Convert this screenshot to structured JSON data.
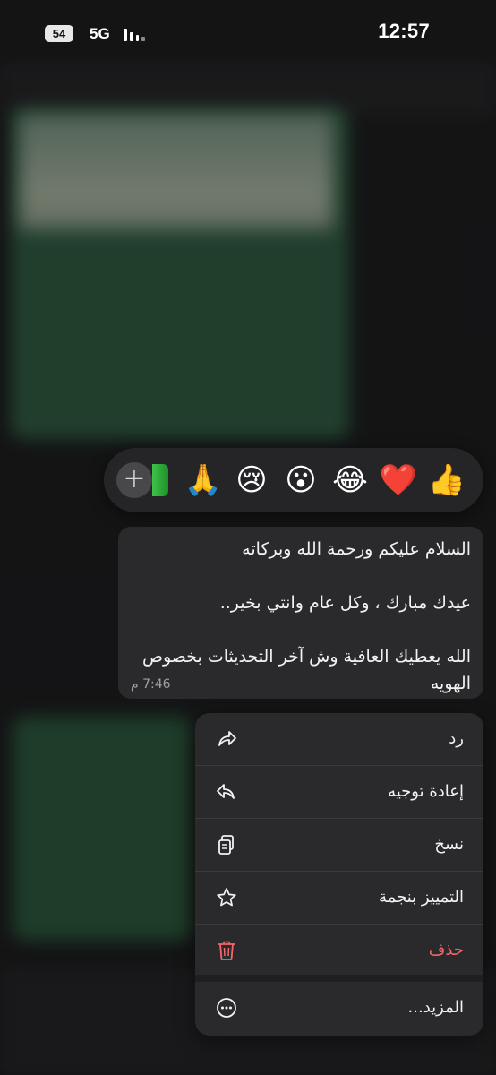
{
  "status_bar": {
    "time": "12:57",
    "network": "5G",
    "battery": "54"
  },
  "reactions": {
    "add_label": "+",
    "items": [
      {
        "name": "thumbs-up",
        "emoji": "👍"
      },
      {
        "name": "red-heart",
        "emoji": "❤️"
      },
      {
        "name": "tears-of-joy",
        "emoji": "😂"
      },
      {
        "name": "surprised",
        "emoji": "😮"
      },
      {
        "name": "crying",
        "emoji": "😢"
      },
      {
        "name": "praying-hands",
        "emoji": "🙏"
      }
    ]
  },
  "message": {
    "line1": "السلام عليكم ورحمة الله وبركاته",
    "line2": "عيدك مبارك ، وكل عام وانتي بخير..",
    "line3": "الله يعطيك العافية وش آخر التحديثات بخصوص الهويه",
    "time": "7:46 م"
  },
  "menu": {
    "reply": {
      "label": "رد",
      "icon": "reply-icon"
    },
    "forward": {
      "label": "إعادة توجيه",
      "icon": "forward-icon"
    },
    "copy": {
      "label": "نسخ",
      "icon": "copy-icon"
    },
    "star": {
      "label": "التمييز بنجمة",
      "icon": "star-icon"
    },
    "delete": {
      "label": "حذف",
      "icon": "trash-icon",
      "color": "#f2676a"
    },
    "more": {
      "label": "المزيد...",
      "icon": "ellipsis-circle-icon"
    }
  }
}
